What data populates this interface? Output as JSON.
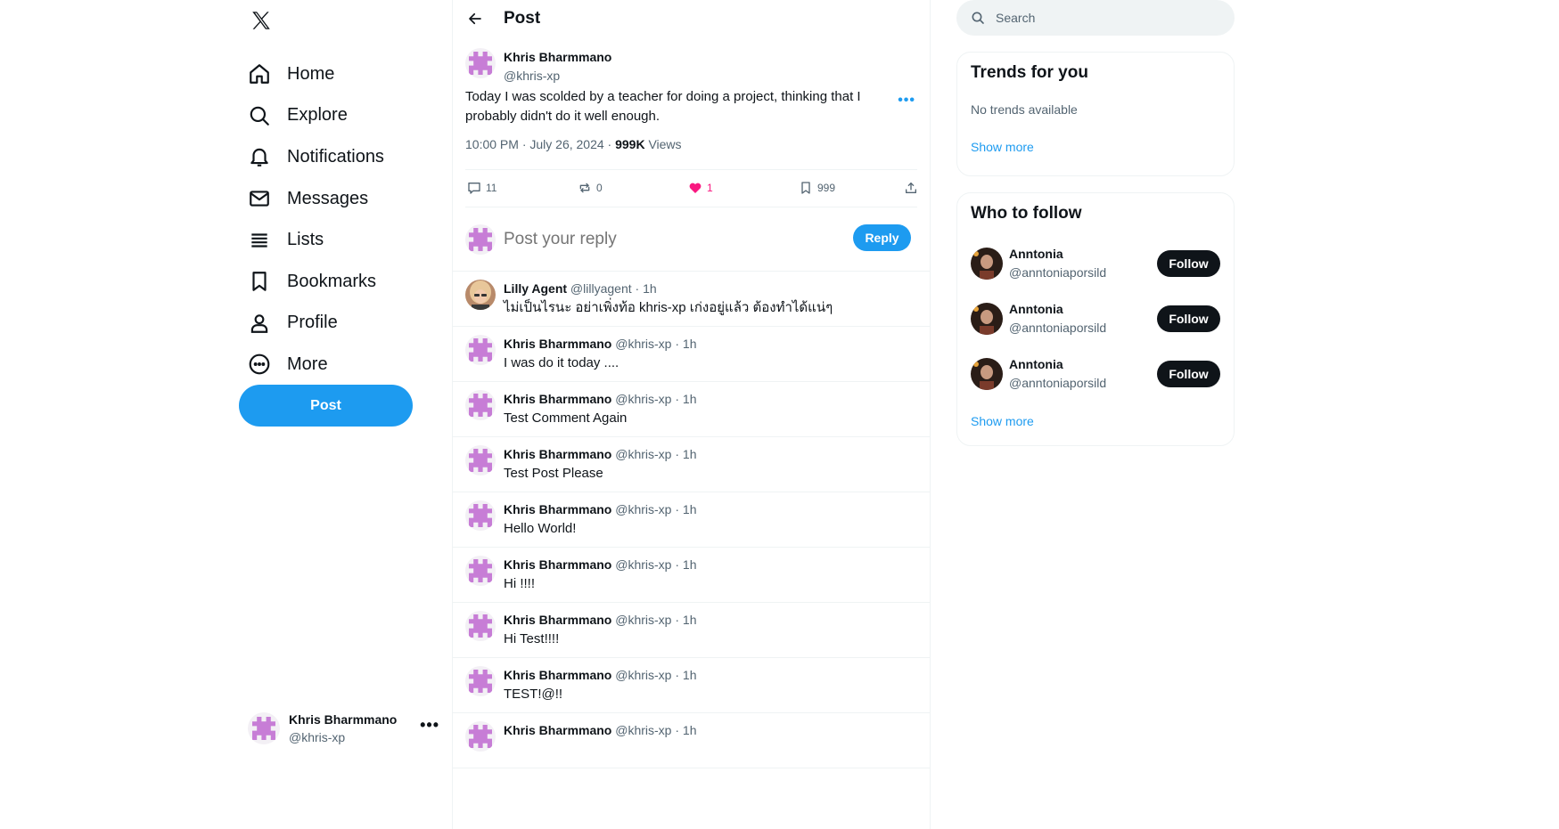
{
  "nav": {
    "logo": "x-logo-icon",
    "items": [
      {
        "label": "Home",
        "icon": "home-icon"
      },
      {
        "label": "Explore",
        "icon": "search-icon"
      },
      {
        "label": "Notifications",
        "icon": "bell-icon"
      },
      {
        "label": "Messages",
        "icon": "envelope-icon"
      },
      {
        "label": "Lists",
        "icon": "list-icon"
      },
      {
        "label": "Bookmarks",
        "icon": "bookmark-icon"
      },
      {
        "label": "Profile",
        "icon": "person-icon"
      },
      {
        "label": "More",
        "icon": "more-circle-icon"
      }
    ],
    "post_button": "Post",
    "account": {
      "name": "Khris Bharmmano",
      "handle": "@khris-xp",
      "more": "•••"
    }
  },
  "main": {
    "header_title": "Post",
    "post": {
      "author": "Khris Bharmmano",
      "handle": "@khris-xp",
      "more": "•••",
      "text": "Today I was scolded by a teacher for doing a project, thinking that I probably didn't do it well enough.",
      "meta_prefix": "10:00 PM · July 26, 2024 · ",
      "views_count": "999K",
      "views_label": " Views",
      "actions": {
        "replies": "11",
        "reposts": "0",
        "likes": "1",
        "bookmarks": "999"
      }
    },
    "reply": {
      "placeholder": "Post your reply",
      "button": "Reply"
    },
    "comments": [
      {
        "name": "Lilly Agent",
        "meta": " @lillyagent · 1h",
        "text": "ไม่เป็นไรนะ อย่าเพิ่งท้อ khris-xp เก่งอยู่แล้ว ต้องทำได้แน่ๆ"
      },
      {
        "name": "Khris Bharmmano",
        "meta": " @khris-xp · 1h",
        "text": "I was do it today ...."
      },
      {
        "name": "Khris Bharmmano",
        "meta": " @khris-xp · 1h",
        "text": "Test Comment Again"
      },
      {
        "name": "Khris Bharmmano",
        "meta": " @khris-xp · 1h",
        "text": "Test Post Please"
      },
      {
        "name": "Khris Bharmmano",
        "meta": " @khris-xp · 1h",
        "text": "Hello World!"
      },
      {
        "name": "Khris Bharmmano",
        "meta": " @khris-xp · 1h",
        "text": "Hi !!!!"
      },
      {
        "name": "Khris Bharmmano",
        "meta": " @khris-xp · 1h",
        "text": "Hi Test!!!!"
      },
      {
        "name": "Khris Bharmmano",
        "meta": " @khris-xp · 1h",
        "text": "TEST!@!!"
      },
      {
        "name": "Khris Bharmmano",
        "meta": " @khris-xp · 1h",
        "text": ""
      }
    ]
  },
  "right": {
    "search_placeholder": "Search",
    "trends": {
      "title": "Trends for you",
      "empty": "No trends available",
      "show_more": "Show more"
    },
    "who_to_follow": {
      "title": "Who to follow",
      "users": [
        {
          "name": "Anntonia",
          "handle": "@anntoniaporsild",
          "button": "Follow"
        },
        {
          "name": "Anntonia",
          "handle": "@anntoniaporsild",
          "button": "Follow"
        },
        {
          "name": "Anntonia",
          "handle": "@anntoniaporsild",
          "button": "Follow"
        }
      ],
      "show_more": "Show more"
    }
  },
  "colors": {
    "accent": "#1d9bf0",
    "like": "#f91880",
    "avatar_pixel": "#c77dd6"
  }
}
